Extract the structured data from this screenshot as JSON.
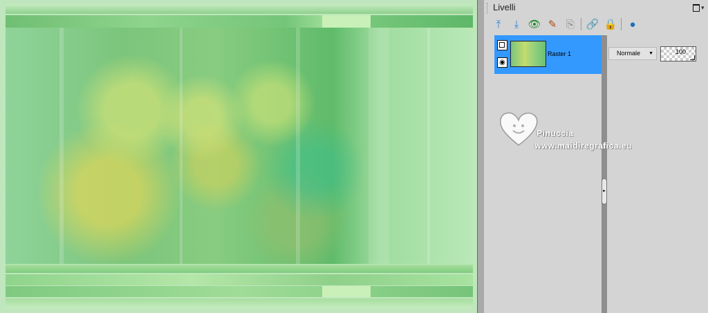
{
  "canvas": {
    "image_description_icon": "raster-image"
  },
  "layers_panel": {
    "title": "Livelli",
    "toolbar": [
      {
        "name": "move-up-icon",
        "glyph": "⤒"
      },
      {
        "name": "move-down-icon",
        "glyph": "⤓"
      },
      {
        "name": "visibility-toggle-icon",
        "glyph": "👁"
      },
      {
        "name": "layer-properties-icon",
        "glyph": "✎"
      },
      {
        "name": "duplicate-icon",
        "glyph": "⎘"
      },
      {
        "name": "link-icon",
        "glyph": "🔗"
      },
      {
        "name": "lock-icon",
        "glyph": "🔒"
      },
      {
        "name": "delete-layer-icon",
        "glyph": "●"
      }
    ],
    "layers": [
      {
        "name": "Raster 1",
        "selected": true,
        "visible": true
      }
    ],
    "blend_mode": "Normale",
    "opacity": "100"
  },
  "watermark": {
    "name": "Pinuccia",
    "url": "www.maidiregrafica.eu"
  },
  "colors": {
    "selection": "#3399ff",
    "panel_bg": "#d4d4d4",
    "splitter": "#8e8e8e"
  }
}
